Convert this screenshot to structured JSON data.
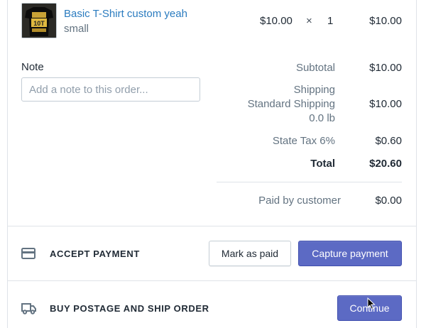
{
  "line_item": {
    "title": "Basic T-Shirt custom yeah",
    "variant": "small",
    "unit_price": "$10.00",
    "times": "×",
    "quantity": "1",
    "line_total": "$10.00"
  },
  "note": {
    "label": "Note",
    "placeholder": "Add a note to this order..."
  },
  "summary": {
    "subtotal_label": "Subtotal",
    "subtotal_value": "$10.00",
    "shipping_label": "Shipping",
    "shipping_method": "Standard Shipping",
    "shipping_weight": "0.0 lb",
    "shipping_value": "$10.00",
    "tax_label": "State Tax 6%",
    "tax_value": "$0.60",
    "total_label": "Total",
    "total_value": "$20.60",
    "paid_label": "Paid by customer",
    "paid_value": "$0.00"
  },
  "payment": {
    "heading": "ACCEPT PAYMENT",
    "mark_paid_label": "Mark as paid",
    "capture_label": "Capture payment"
  },
  "shipping_section": {
    "heading": "BUY POSTAGE AND SHIP ORDER",
    "continue_label": "Continue"
  },
  "icons": {
    "payment": "credit-card-icon",
    "shipping": "truck-icon",
    "cursor": "mouse-pointer-icon"
  },
  "colors": {
    "link": "#2a7bbf",
    "primary": "#5c6ac4",
    "muted": "#637381",
    "border": "#dfe3e8"
  }
}
